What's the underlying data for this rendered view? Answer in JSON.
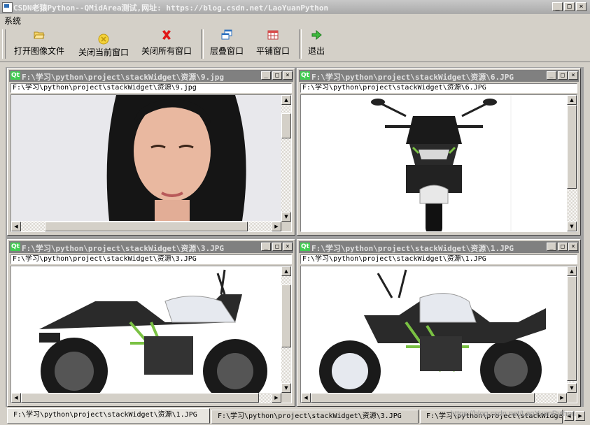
{
  "window": {
    "title": "CSDN老猿Python--QMidArea测试,网址: https://blog.csdn.net/LaoYuanPython",
    "btn_min": "_",
    "btn_max": "□",
    "btn_close": "×"
  },
  "menu": {
    "items": [
      "系统"
    ]
  },
  "toolbar": {
    "open": "打开图像文件",
    "close_current": "关闭当前窗口",
    "close_all": "关闭所有窗口",
    "cascade": "层叠窗口",
    "tile": "平铺窗口",
    "exit": "退出"
  },
  "subwindows": [
    {
      "title": "F:\\学习\\python\\project\\stackWidget\\资源\\9.jpg",
      "path": "F:\\学习\\python\\project\\stackWidget\\资源\\9.jpg",
      "image": "woman-portrait"
    },
    {
      "title": "F:\\学习\\python\\project\\stackWidget\\资源\\6.JPG",
      "path": "F:\\学习\\python\\project\\stackWidget\\资源\\6.JPG",
      "image": "motorcycle-front"
    },
    {
      "title": "F:\\学习\\python\\project\\stackWidget\\资源\\3.JPG",
      "path": "F:\\学习\\python\\project\\stackWidget\\资源\\3.JPG",
      "image": "motorcycle-side"
    },
    {
      "title": "F:\\学习\\python\\project\\stackWidget\\资源\\1.JPG",
      "path": "F:\\学习\\python\\project\\stackWidget\\资源\\1.JPG",
      "image": "motorcycle-angle"
    }
  ],
  "tabs": [
    "F:\\学习\\python\\project\\stackWidget\\资源\\1.JPG",
    "F:\\学习\\python\\project\\stackWidget\\资源\\3.JPG",
    "F:\\学习\\python\\project\\stackWidget"
  ],
  "watermark": "https://blog.csdn.net/LaoYuanPython",
  "colors": {
    "face": "#d4d0c8",
    "mdi": "#a0a0a0",
    "caption": "#808080",
    "qt": "#41cd52"
  }
}
